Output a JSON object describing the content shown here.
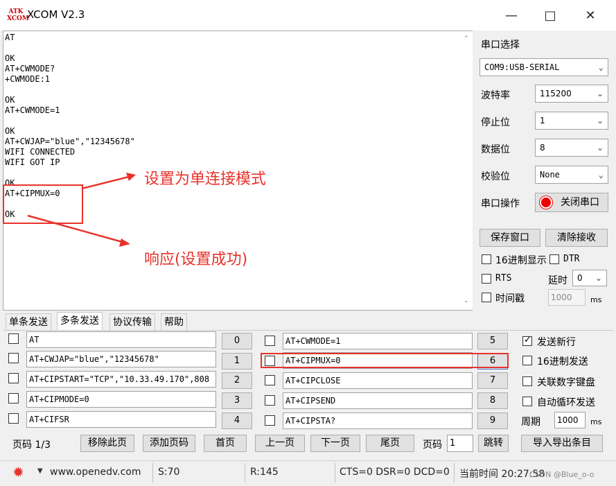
{
  "window": {
    "title": "XCOM V2.3",
    "logo_text": "ATK XCOM",
    "minimize": "—",
    "maximize": "□",
    "close": "✕"
  },
  "receive": {
    "lines": [
      "AT",
      "",
      "OK",
      "AT+CWMODE?",
      "+CWMODE:1",
      "",
      "OK",
      "AT+CWMODE=1",
      "",
      "OK",
      "AT+CWJAP=\"blue\",\"12345678\"",
      "WIFI CONNECTED",
      "WIFI GOT IP",
      "",
      "OK",
      "AT+CIPMUX=0",
      "",
      "OK"
    ]
  },
  "annotations": {
    "top": "设置为单连接模式",
    "bottom": "响应(设置成功)"
  },
  "panel": {
    "port_label": "串口选择",
    "port_value": "COM9:USB-SERIAL",
    "baud_label": "波特率",
    "baud_value": "115200",
    "stop_label": "停止位",
    "stop_value": "1",
    "data_label": "数据位",
    "data_value": "8",
    "parity_label": "校验位",
    "parity_value": "None",
    "op_label": "串口操作",
    "op_button": "关闭串口",
    "save_button": "保存窗口",
    "clear_button": "清除接收",
    "hex_display": "16进制显示",
    "dtr": "DTR",
    "rts": "RTS",
    "delay_label": "延时",
    "delay_value": "0",
    "timestamp": "时间戳",
    "timestamp_value": "1000",
    "ms": "ms"
  },
  "tabs": [
    "单条发送",
    "多条发送",
    "协议传输",
    "帮助"
  ],
  "multi_send": {
    "left": [
      {
        "num": "0",
        "text": "AT"
      },
      {
        "num": "1",
        "text": "AT+CWJAP=\"blue\",\"12345678\""
      },
      {
        "num": "2",
        "text": "AT+CIPSTART=\"TCP\",\"10.33.49.170\",808"
      },
      {
        "num": "3",
        "text": "AT+CIPMODE=0"
      },
      {
        "num": "4",
        "text": "AT+CIFSR"
      }
    ],
    "right": [
      {
        "num": "5",
        "text": "AT+CWMODE=1"
      },
      {
        "num": "6",
        "text": "AT+CIPMUX=0"
      },
      {
        "num": "7",
        "text": "AT+CIPCLOSE"
      },
      {
        "num": "8",
        "text": "AT+CIPSEND"
      },
      {
        "num": "9",
        "text": "AT+CIPSTA?"
      }
    ],
    "options": {
      "newline": "发送新行",
      "hex_send": "16进制发送",
      "numpad": "关联数字键盘",
      "loop": "自动循环发送",
      "period_label": "周期",
      "period_value": "1000",
      "ms": "ms"
    }
  },
  "pager": {
    "page": "页码 1/3",
    "remove": "移除此页",
    "add": "添加页码",
    "first": "首页",
    "prev": "上一页",
    "next": "下一页",
    "last": "尾页",
    "goto_label": "页码",
    "goto_value": "1",
    "jump": "跳转",
    "import_export": "导入导出条目"
  },
  "status": {
    "website": "www.openedv.com",
    "sent": "S:70",
    "received": "R:145",
    "signals": "CTS=0 DSR=0 DCD=0",
    "time": "当前时间 20:27:58",
    "watermark": "CSDN @Blue_o-o"
  },
  "colors": {
    "annotation": "#e8322a"
  }
}
